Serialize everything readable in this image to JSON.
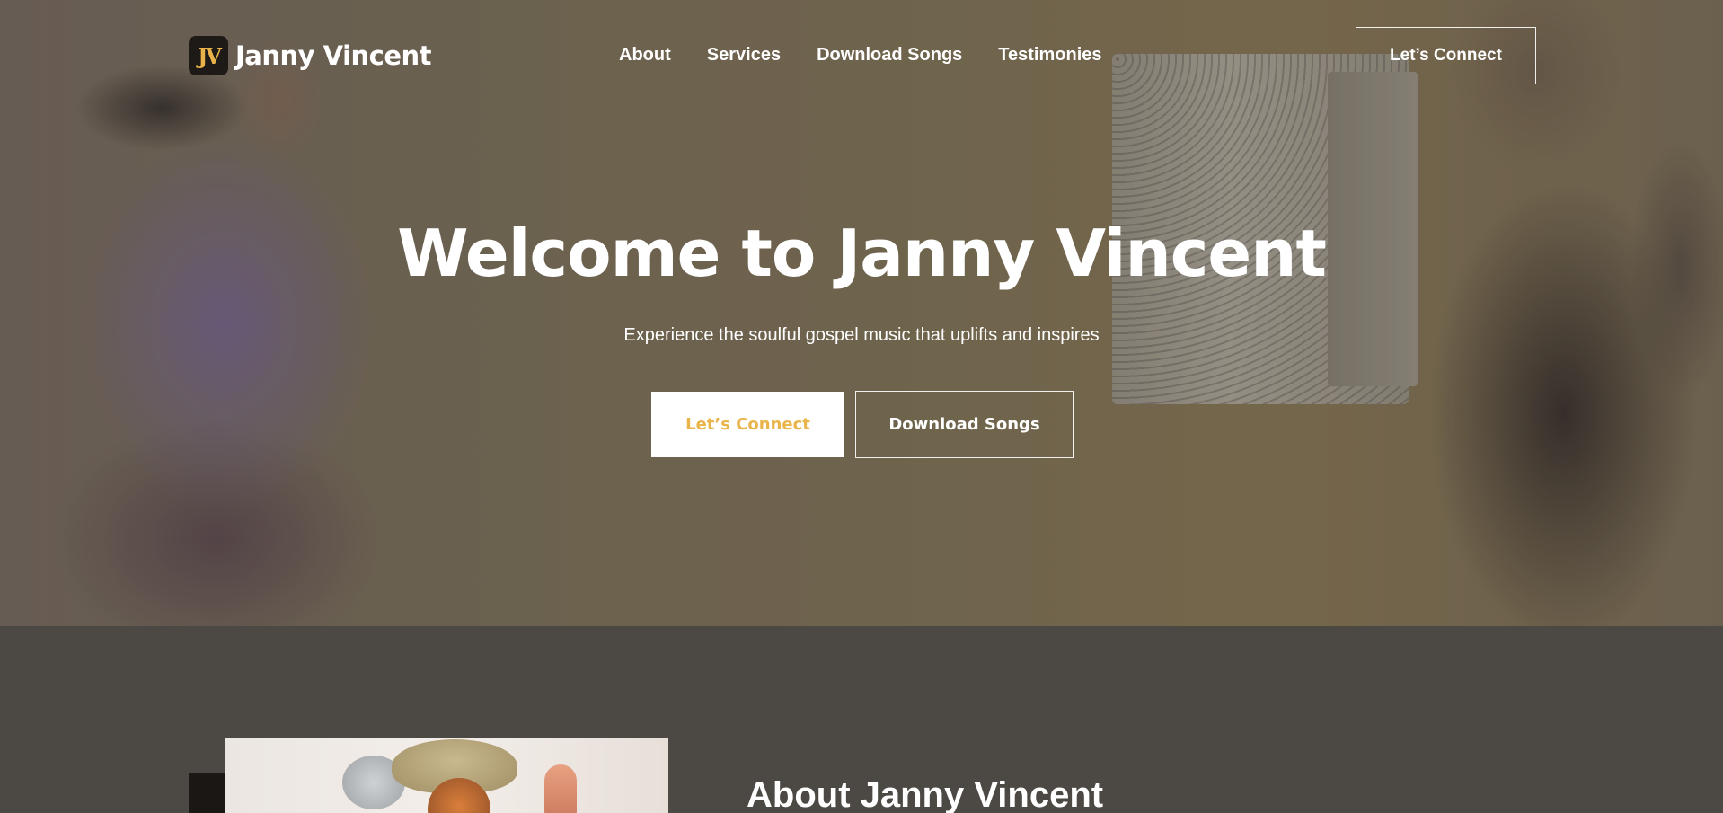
{
  "brand": {
    "logo_mark": "JV",
    "name": "Janny Vincent"
  },
  "nav": {
    "items": [
      {
        "label": "About"
      },
      {
        "label": "Services"
      },
      {
        "label": "Download Songs"
      },
      {
        "label": "Testimonies"
      }
    ],
    "cta_label": "Let’s Connect"
  },
  "hero": {
    "title": "Welcome to Janny Vincent",
    "subtitle": "Experience the soulful gospel music that uplifts and inspires",
    "primary_button": "Let’s Connect",
    "secondary_button": "Download Songs"
  },
  "about": {
    "title": "About Janny Vincent"
  },
  "colors": {
    "accent": "#e9b54a",
    "hero_bg": "#74684e",
    "about_bg": "#4c4843"
  }
}
